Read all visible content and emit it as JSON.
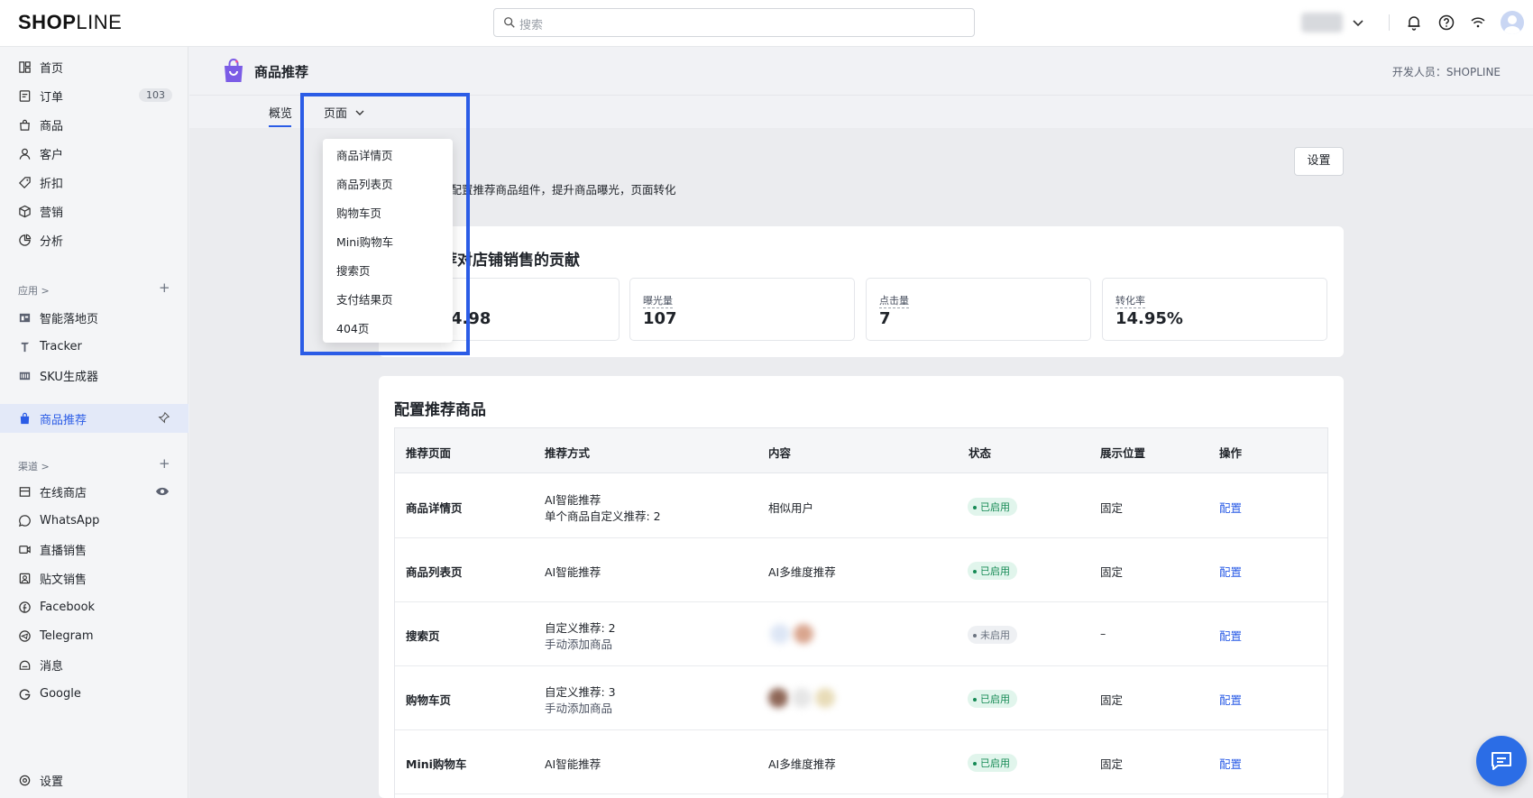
{
  "brand": {
    "logo_bold": "SH",
    "logo_o": "O",
    "logo_rest_bold": "P",
    "logo_thin": "LINE"
  },
  "search": {
    "placeholder": "搜索"
  },
  "sidebar": {
    "main_items": [
      {
        "label": "首页",
        "icon": "dashboard-icon"
      },
      {
        "label": "订单",
        "icon": "order-icon",
        "badge": "103"
      },
      {
        "label": "商品",
        "icon": "bag-icon"
      },
      {
        "label": "客户",
        "icon": "user-icon"
      },
      {
        "label": "折扣",
        "icon": "tag-icon"
      },
      {
        "label": "营销",
        "icon": "cube-icon"
      },
      {
        "label": "分析",
        "icon": "chart-icon"
      }
    ],
    "apps_title": "应用 >",
    "apps": [
      {
        "label": "智能落地页",
        "icon": "landing-icon"
      },
      {
        "label": "Tracker",
        "icon": "tracker-icon"
      },
      {
        "label": "SKU生成器",
        "icon": "sku-icon"
      }
    ],
    "active_app": {
      "label": "商品推荐",
      "icon": "recommend-icon"
    },
    "channels_title": "渠道 >",
    "channels": [
      {
        "label": "在线商店",
        "icon": "store-icon"
      },
      {
        "label": "WhatsApp",
        "icon": "whatsapp-icon"
      },
      {
        "label": "直播销售",
        "icon": "live-icon"
      },
      {
        "label": "贴文销售",
        "icon": "post-icon"
      },
      {
        "label": "Facebook",
        "icon": "facebook-icon"
      },
      {
        "label": "Telegram",
        "icon": "telegram-icon"
      },
      {
        "label": "消息",
        "icon": "message-icon"
      },
      {
        "label": "Google",
        "icon": "google-icon"
      }
    ],
    "settings": "设置"
  },
  "header": {
    "title": "商品推荐",
    "developer": "开发人员：SHOPLINE"
  },
  "tabs": {
    "overview": "概览",
    "page": "页面"
  },
  "overview": {
    "title_partial": "：",
    "desc_partial": "置配置推荐商品组件，提升商品曝光，页面转化",
    "settings_button": "设置"
  },
  "contribution": {
    "title_partial": "荐对店铺销售的贡献",
    "metrics": [
      {
        "label": "",
        "value": "4.98"
      },
      {
        "label": "曝光量",
        "value": "107"
      },
      {
        "label": "点击量",
        "value": "7"
      },
      {
        "label": "转化率",
        "value": "14.95%"
      }
    ]
  },
  "config": {
    "title": "配置推荐商品",
    "columns": [
      "推荐页面",
      "推荐方式",
      "内容",
      "状态",
      "展示位置",
      "操作"
    ],
    "rows": [
      {
        "page": "商品详情页",
        "method": "AI智能推荐",
        "method2": "单个商品自定义推荐: 2",
        "content": "相似用户",
        "status": "已启用",
        "position": "固定",
        "action": "配置"
      },
      {
        "page": "商品列表页",
        "method": "AI智能推荐",
        "method2": "",
        "content": "AI多维度推荐",
        "status": "已启用",
        "position": "固定",
        "action": "配置"
      },
      {
        "page": "搜索页",
        "method": "自定义推荐: 2",
        "method2": "手动添加商品",
        "content": "",
        "status": "未启用",
        "position": "–",
        "action": "配置"
      },
      {
        "page": "购物车页",
        "method": "自定义推荐: 3",
        "method2": "手动添加商品",
        "content": "",
        "status": "已启用",
        "position": "固定",
        "action": "配置"
      },
      {
        "page": "Mini购物车",
        "method": "AI智能推荐",
        "method2": "",
        "content": "AI多维度推荐",
        "status": "已启用",
        "position": "固定",
        "action": "配置"
      }
    ]
  },
  "dropdown": {
    "items": [
      "商品详情页",
      "商品列表页",
      "购物车页",
      "Mini购物车",
      "搜索页",
      "支付结果页",
      "404页"
    ]
  },
  "colors": {
    "accent": "#2b5ce6",
    "status_on": "#168a55",
    "highlight": "#2b5ce6"
  }
}
